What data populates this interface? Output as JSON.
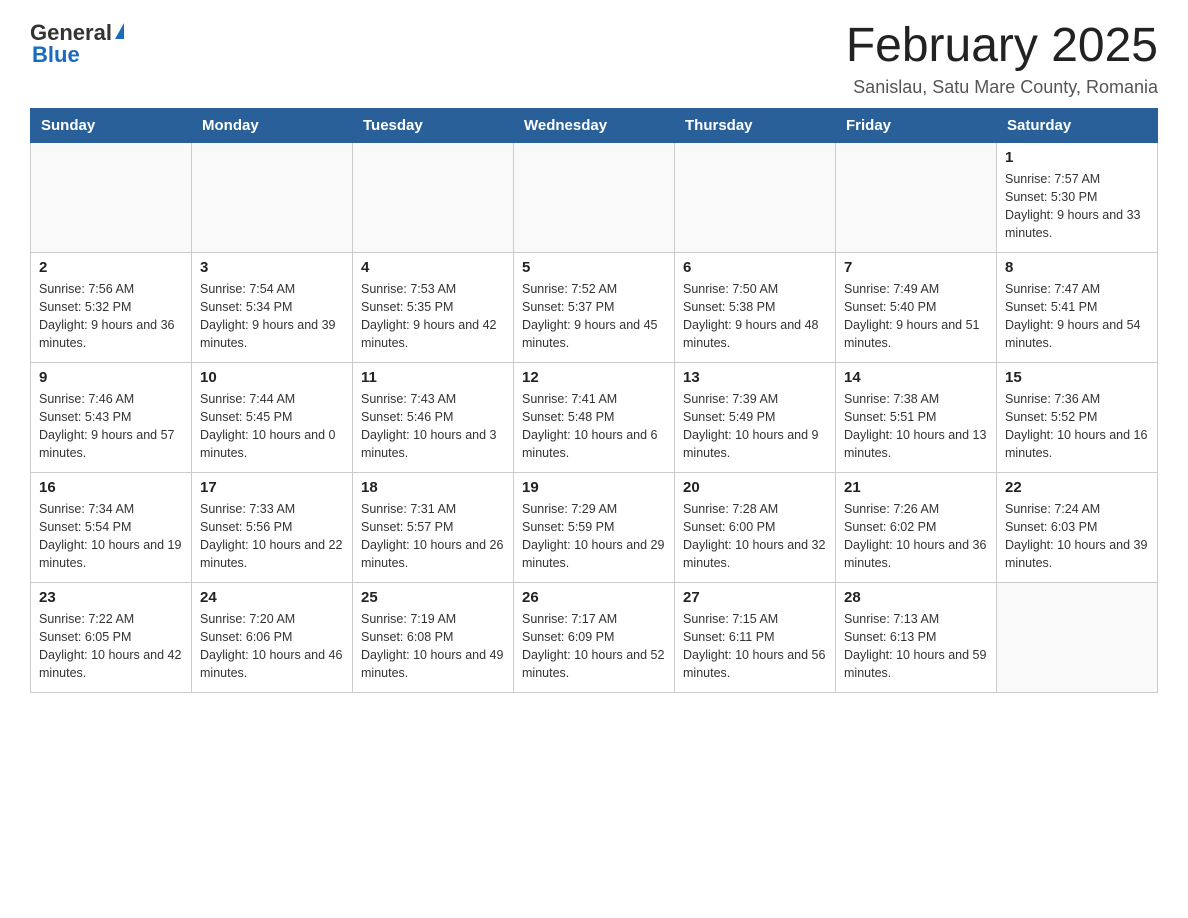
{
  "header": {
    "logo_general": "General",
    "logo_blue": "Blue",
    "month_title": "February 2025",
    "location": "Sanislau, Satu Mare County, Romania"
  },
  "weekdays": [
    "Sunday",
    "Monday",
    "Tuesday",
    "Wednesday",
    "Thursday",
    "Friday",
    "Saturday"
  ],
  "weeks": [
    [
      {
        "day": "",
        "info": ""
      },
      {
        "day": "",
        "info": ""
      },
      {
        "day": "",
        "info": ""
      },
      {
        "day": "",
        "info": ""
      },
      {
        "day": "",
        "info": ""
      },
      {
        "day": "",
        "info": ""
      },
      {
        "day": "1",
        "info": "Sunrise: 7:57 AM\nSunset: 5:30 PM\nDaylight: 9 hours and 33 minutes."
      }
    ],
    [
      {
        "day": "2",
        "info": "Sunrise: 7:56 AM\nSunset: 5:32 PM\nDaylight: 9 hours and 36 minutes."
      },
      {
        "day": "3",
        "info": "Sunrise: 7:54 AM\nSunset: 5:34 PM\nDaylight: 9 hours and 39 minutes."
      },
      {
        "day": "4",
        "info": "Sunrise: 7:53 AM\nSunset: 5:35 PM\nDaylight: 9 hours and 42 minutes."
      },
      {
        "day": "5",
        "info": "Sunrise: 7:52 AM\nSunset: 5:37 PM\nDaylight: 9 hours and 45 minutes."
      },
      {
        "day": "6",
        "info": "Sunrise: 7:50 AM\nSunset: 5:38 PM\nDaylight: 9 hours and 48 minutes."
      },
      {
        "day": "7",
        "info": "Sunrise: 7:49 AM\nSunset: 5:40 PM\nDaylight: 9 hours and 51 minutes."
      },
      {
        "day": "8",
        "info": "Sunrise: 7:47 AM\nSunset: 5:41 PM\nDaylight: 9 hours and 54 minutes."
      }
    ],
    [
      {
        "day": "9",
        "info": "Sunrise: 7:46 AM\nSunset: 5:43 PM\nDaylight: 9 hours and 57 minutes."
      },
      {
        "day": "10",
        "info": "Sunrise: 7:44 AM\nSunset: 5:45 PM\nDaylight: 10 hours and 0 minutes."
      },
      {
        "day": "11",
        "info": "Sunrise: 7:43 AM\nSunset: 5:46 PM\nDaylight: 10 hours and 3 minutes."
      },
      {
        "day": "12",
        "info": "Sunrise: 7:41 AM\nSunset: 5:48 PM\nDaylight: 10 hours and 6 minutes."
      },
      {
        "day": "13",
        "info": "Sunrise: 7:39 AM\nSunset: 5:49 PM\nDaylight: 10 hours and 9 minutes."
      },
      {
        "day": "14",
        "info": "Sunrise: 7:38 AM\nSunset: 5:51 PM\nDaylight: 10 hours and 13 minutes."
      },
      {
        "day": "15",
        "info": "Sunrise: 7:36 AM\nSunset: 5:52 PM\nDaylight: 10 hours and 16 minutes."
      }
    ],
    [
      {
        "day": "16",
        "info": "Sunrise: 7:34 AM\nSunset: 5:54 PM\nDaylight: 10 hours and 19 minutes."
      },
      {
        "day": "17",
        "info": "Sunrise: 7:33 AM\nSunset: 5:56 PM\nDaylight: 10 hours and 22 minutes."
      },
      {
        "day": "18",
        "info": "Sunrise: 7:31 AM\nSunset: 5:57 PM\nDaylight: 10 hours and 26 minutes."
      },
      {
        "day": "19",
        "info": "Sunrise: 7:29 AM\nSunset: 5:59 PM\nDaylight: 10 hours and 29 minutes."
      },
      {
        "day": "20",
        "info": "Sunrise: 7:28 AM\nSunset: 6:00 PM\nDaylight: 10 hours and 32 minutes."
      },
      {
        "day": "21",
        "info": "Sunrise: 7:26 AM\nSunset: 6:02 PM\nDaylight: 10 hours and 36 minutes."
      },
      {
        "day": "22",
        "info": "Sunrise: 7:24 AM\nSunset: 6:03 PM\nDaylight: 10 hours and 39 minutes."
      }
    ],
    [
      {
        "day": "23",
        "info": "Sunrise: 7:22 AM\nSunset: 6:05 PM\nDaylight: 10 hours and 42 minutes."
      },
      {
        "day": "24",
        "info": "Sunrise: 7:20 AM\nSunset: 6:06 PM\nDaylight: 10 hours and 46 minutes."
      },
      {
        "day": "25",
        "info": "Sunrise: 7:19 AM\nSunset: 6:08 PM\nDaylight: 10 hours and 49 minutes."
      },
      {
        "day": "26",
        "info": "Sunrise: 7:17 AM\nSunset: 6:09 PM\nDaylight: 10 hours and 52 minutes."
      },
      {
        "day": "27",
        "info": "Sunrise: 7:15 AM\nSunset: 6:11 PM\nDaylight: 10 hours and 56 minutes."
      },
      {
        "day": "28",
        "info": "Sunrise: 7:13 AM\nSunset: 6:13 PM\nDaylight: 10 hours and 59 minutes."
      },
      {
        "day": "",
        "info": ""
      }
    ]
  ]
}
